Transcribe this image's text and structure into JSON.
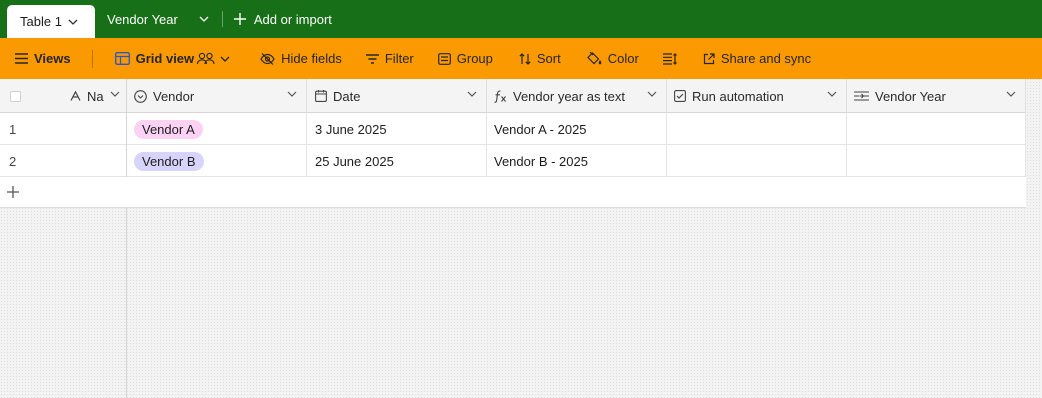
{
  "tabs": {
    "active": "Table 1",
    "second": "Vendor Year",
    "add": "Add or import"
  },
  "toolbar": {
    "views": "Views",
    "grid_view": "Grid view",
    "hide_fields": "Hide fields",
    "filter": "Filter",
    "group": "Group",
    "sort": "Sort",
    "color": "Color",
    "share": "Share and sync"
  },
  "columns": {
    "name": "Na",
    "vendor": "Vendor",
    "date": "Date",
    "vendor_year_text": "Vendor year as text",
    "run_automation": "Run automation",
    "vendor_year": "Vendor Year"
  },
  "rows": [
    {
      "num": "1",
      "vendor": "Vendor A",
      "vendor_color": "#fbd2f3",
      "date": "3 June 2025",
      "vendor_year_text": "Vendor A - 2025"
    },
    {
      "num": "2",
      "vendor": "Vendor B",
      "vendor_color": "#d7d4fb",
      "date": "25 June 2025",
      "vendor_year_text": "Vendor B - 2025"
    }
  ],
  "icons": {
    "tab_chevron": "chevron-down-icon",
    "add": "plus-icon",
    "views": "hamburger-icon",
    "grid": "grid-icon",
    "collaborators": "people-icon",
    "hide_fields": "eye-slash-icon",
    "filter": "filter-icon",
    "group": "group-icon",
    "sort": "sort-icon",
    "color": "paint-bucket-icon",
    "row_height": "row-height-icon",
    "share": "external-link-icon",
    "name_field": "text-type-icon",
    "vendor_field": "single-select-icon",
    "date_field": "calendar-icon",
    "formula_field": "formula-icon",
    "checkbox_field": "checkbox-icon",
    "lookup_field": "lookup-icon"
  },
  "colors": {
    "tabbar": "#177017",
    "toolbar": "#fb9a00"
  }
}
